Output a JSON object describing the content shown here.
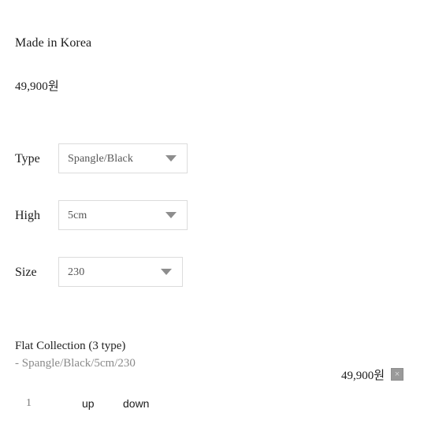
{
  "product": {
    "origin_label": "Made in Korea",
    "price": "49,900원"
  },
  "options": [
    {
      "label": "Type",
      "selected": "Spangle/Black",
      "arrow_icon": "chevron-down-icon"
    },
    {
      "label": "High",
      "selected": "5cm",
      "arrow_icon": "chevron-down-icon"
    },
    {
      "label": "Size",
      "selected": "230",
      "arrow_icon": "chevron-down-icon"
    }
  ],
  "cart_item": {
    "title": "Flat Collection (3 type)",
    "option_summary": "- Spangle/Black/5cm/230",
    "price": "49,900원",
    "delete_icon": "close-icon",
    "delete_glyph": "×",
    "quantity": "1",
    "increase_label": "up",
    "decrease_label": "down"
  },
  "colors": {
    "background": "#ffffff",
    "text_primary": "#1c1c1c",
    "text_muted": "#8a8a8a",
    "select_border": "#dcdcdc",
    "select_value": "#555555",
    "arrow": "#8d8d8d",
    "delete_button": "#9a9a9a"
  }
}
